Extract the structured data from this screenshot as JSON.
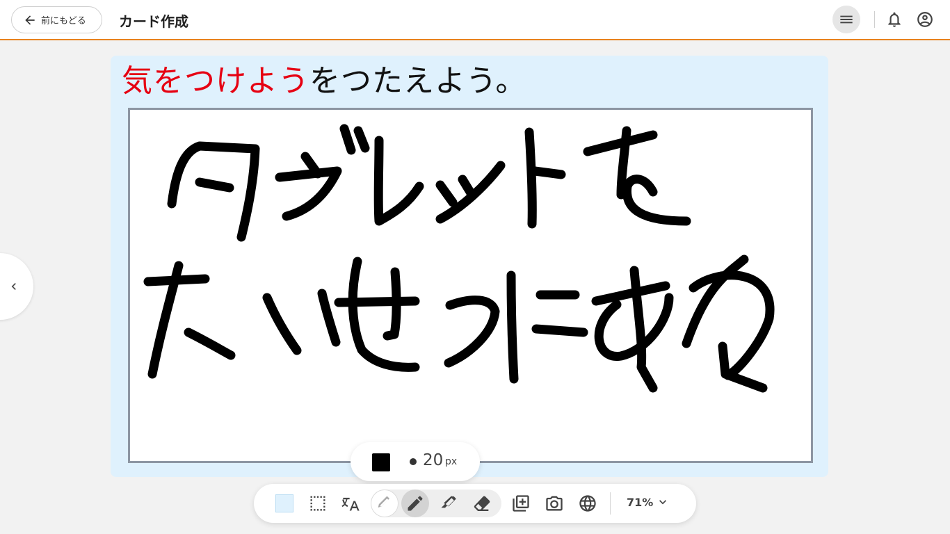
{
  "header": {
    "back_label": "前にもどる",
    "title": "カード作成",
    "icons": [
      "arrow-left-icon",
      "menu-icon",
      "bell-icon",
      "account-circle-icon"
    ]
  },
  "card": {
    "prompt_highlight": "気をつけよう",
    "prompt_rest": "をつたえよう。",
    "background_color": "#dff1fd",
    "highlight_color": "#e60012"
  },
  "pen_options": {
    "color": "#000000",
    "size_value": "20",
    "size_unit": "px"
  },
  "toolbar": {
    "tools": [
      "background-color",
      "select-icon",
      "text-icon",
      "pen-light-icon",
      "pen-icon",
      "marker-icon",
      "eraser-icon",
      "add-card-icon",
      "camera-icon",
      "web-icon"
    ],
    "selected_tool": "pen",
    "zoom": "71%"
  },
  "nav": {
    "prev_icon": "chevron-left-icon"
  }
}
